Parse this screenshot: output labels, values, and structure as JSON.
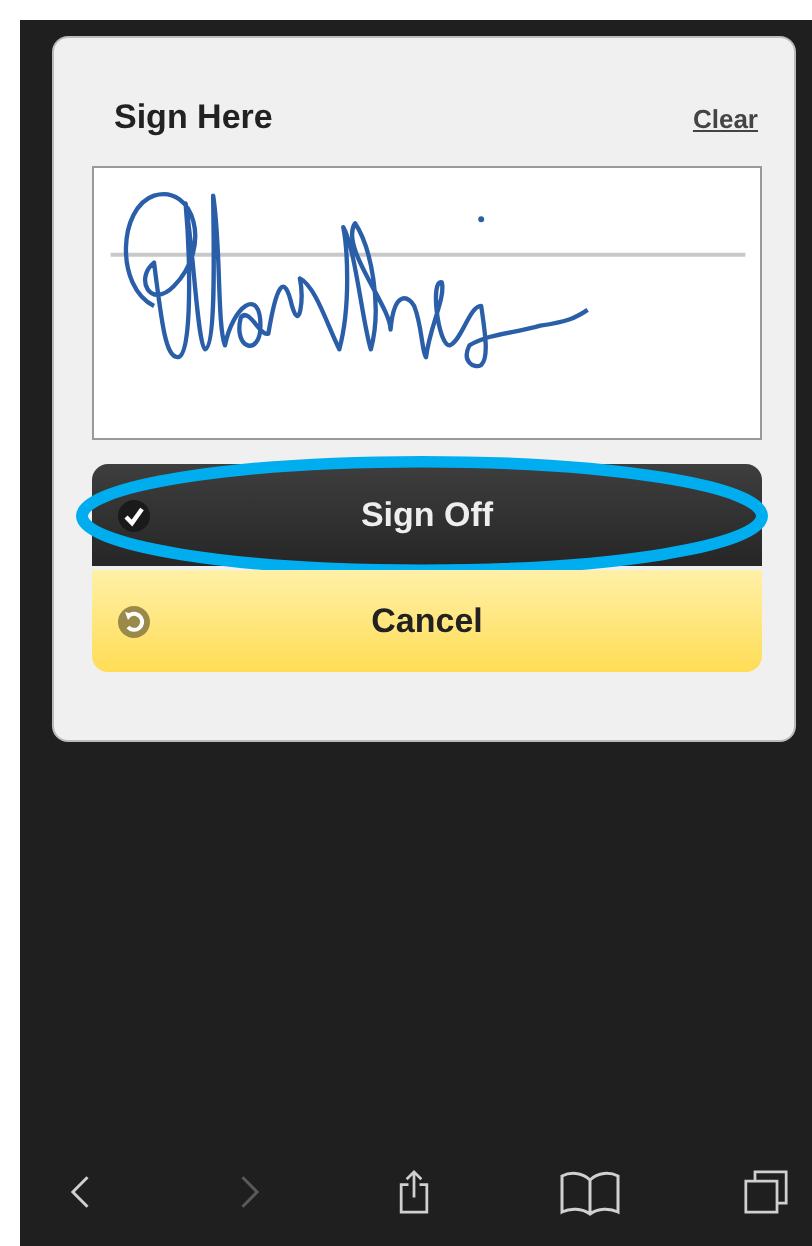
{
  "dialog": {
    "title": "Sign Here",
    "clear_link": "Clear"
  },
  "buttons": [
    {
      "kind": "confirm",
      "label": "Sign Off",
      "highlighted": true
    },
    {
      "kind": "cancel",
      "label": "Cancel",
      "highlighted": false
    }
  ],
  "toolbar": [
    {
      "kind": "back",
      "disabled": false
    },
    {
      "kind": "forward",
      "disabled": true
    },
    {
      "kind": "share",
      "disabled": false
    },
    {
      "kind": "bookmarks",
      "disabled": false
    },
    {
      "kind": "tabs",
      "disabled": false
    }
  ]
}
